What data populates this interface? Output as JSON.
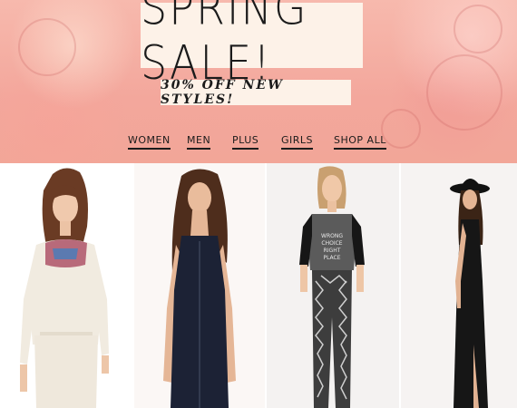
{
  "hero": {
    "title": "SPRING SALE!",
    "subtitle": "30% OFF NEW STYLES!"
  },
  "nav": {
    "items": [
      {
        "label": "WOMEN"
      },
      {
        "label": "MEN"
      },
      {
        "label": "PLUS"
      },
      {
        "label": "GIRLS"
      },
      {
        "label": "SHOP ALL"
      }
    ]
  },
  "products": {
    "tiles": [
      {
        "name": "white embroidered romper",
        "color": "#f1ebe0"
      },
      {
        "name": "navy zip-front dress",
        "color": "#1c2235"
      },
      {
        "name": "printed tee and jogger set",
        "tee_text": "WRONG CHOICE RIGHT PLACE"
      },
      {
        "name": "black maxi dress",
        "color": "#161616"
      }
    ]
  },
  "colors": {
    "hero_pink": "#f3a79c",
    "label_bg": "#fdf2e8",
    "text": "#1b1b1b"
  }
}
